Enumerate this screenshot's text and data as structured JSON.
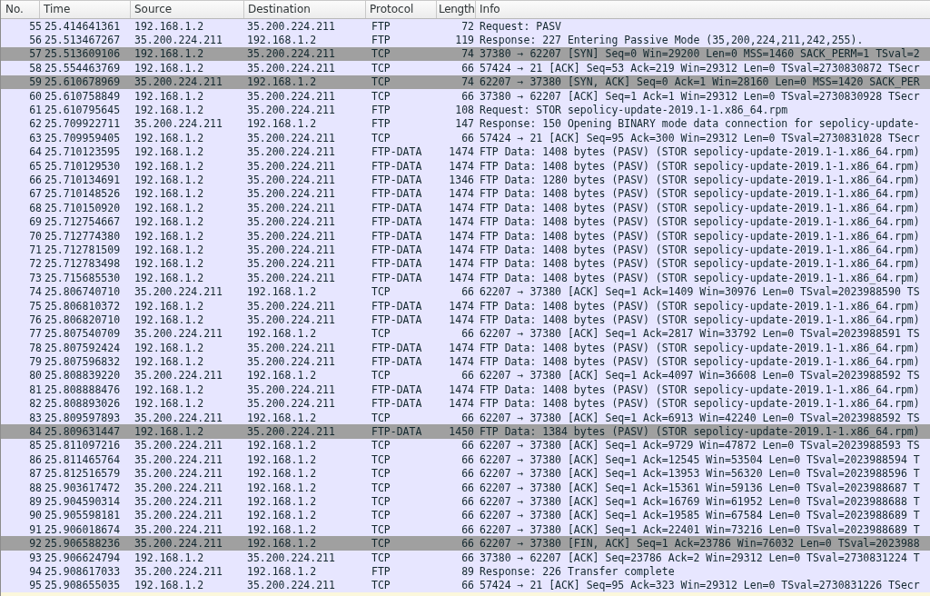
{
  "packet_list": {
    "columns": [
      "No.",
      "Time",
      "Source",
      "Destination",
      "Protocol",
      "Length",
      "Info"
    ],
    "rows": [
      {
        "no": "55",
        "time": "25.414641361",
        "source": "192.168.1.2",
        "destination": "35.200.224.211",
        "protocol": "FTP",
        "length": "72",
        "info": "Request: PASV",
        "color": "#e7e6ff",
        "selected": false
      },
      {
        "no": "56",
        "time": "25.513467267",
        "source": "35.200.224.211",
        "destination": "192.168.1.2",
        "protocol": "FTP",
        "length": "119",
        "info": "Response: 227 Entering Passive Mode (35,200,224,211,242,255).",
        "color": "#e7e6ff",
        "selected": false
      },
      {
        "no": "57",
        "time": "25.513609106",
        "source": "192.168.1.2",
        "destination": "35.200.224.211",
        "protocol": "TCP",
        "length": "74",
        "info": "37380 → 62207 [SYN] Seq=0 Win=29200 Len=0 MSS=1460 SACK_PERM=1 TSval=2",
        "color": "#a0a0a0",
        "selected": false
      },
      {
        "no": "58",
        "time": "25.554463769",
        "source": "192.168.1.2",
        "destination": "35.200.224.211",
        "protocol": "TCP",
        "length": "66",
        "info": "57424 → 21 [ACK] Seq=53 Ack=219 Win=29312 Len=0 TSval=2730830872 TSecr",
        "color": "#e7e6ff",
        "selected": false
      },
      {
        "no": "59",
        "time": "25.610678969",
        "source": "35.200.224.211",
        "destination": "192.168.1.2",
        "protocol": "TCP",
        "length": "74",
        "info": "62207 → 37380 [SYN, ACK] Seq=0 Ack=1 Win=28160 Len=0 MSS=1420 SACK_PER",
        "color": "#a0a0a0",
        "selected": false
      },
      {
        "no": "60",
        "time": "25.610758849",
        "source": "192.168.1.2",
        "destination": "35.200.224.211",
        "protocol": "TCP",
        "length": "66",
        "info": "37380 → 62207 [ACK] Seq=1 Ack=1 Win=29312 Len=0 TSval=2730830928 TSecr",
        "color": "#e7e6ff",
        "selected": false
      },
      {
        "no": "61",
        "time": "25.610795645",
        "source": "192.168.1.2",
        "destination": "35.200.224.211",
        "protocol": "FTP",
        "length": "108",
        "info": "Request: STOR sepolicy-update-2019.1-1.x86_64.rpm",
        "color": "#e7e6ff",
        "selected": false
      },
      {
        "no": "62",
        "time": "25.709922711",
        "source": "35.200.224.211",
        "destination": "192.168.1.2",
        "protocol": "FTP",
        "length": "147",
        "info": "Response: 150 Opening BINARY mode data connection for sepolicy-update-",
        "color": "#e7e6ff",
        "selected": false
      },
      {
        "no": "63",
        "time": "25.709959405",
        "source": "192.168.1.2",
        "destination": "35.200.224.211",
        "protocol": "TCP",
        "length": "66",
        "info": "57424 → 21 [ACK] Seq=95 Ack=300 Win=29312 Len=0 TSval=2730831028 TSecr",
        "color": "#e7e6ff",
        "selected": false
      },
      {
        "no": "64",
        "time": "25.710123595",
        "source": "192.168.1.2",
        "destination": "35.200.224.211",
        "protocol": "FTP-DATA",
        "length": "1474",
        "info": "FTP Data: 1408 bytes (PASV) (STOR sepolicy-update-2019.1-1.x86_64.rpm)",
        "color": "#e7e6ff",
        "selected": false
      },
      {
        "no": "65",
        "time": "25.710129530",
        "source": "192.168.1.2",
        "destination": "35.200.224.211",
        "protocol": "FTP-DATA",
        "length": "1474",
        "info": "FTP Data: 1408 bytes (PASV) (STOR sepolicy-update-2019.1-1.x86_64.rpm)",
        "color": "#e7e6ff",
        "selected": false
      },
      {
        "no": "66",
        "time": "25.710134691",
        "source": "192.168.1.2",
        "destination": "35.200.224.211",
        "protocol": "FTP-DATA",
        "length": "1346",
        "info": "FTP Data: 1280 bytes (PASV) (STOR sepolicy-update-2019.1-1.x86_64.rpm)",
        "color": "#e7e6ff",
        "selected": false
      },
      {
        "no": "67",
        "time": "25.710148526",
        "source": "192.168.1.2",
        "destination": "35.200.224.211",
        "protocol": "FTP-DATA",
        "length": "1474",
        "info": "FTP Data: 1408 bytes (PASV) (STOR sepolicy-update-2019.1-1.x86_64.rpm)",
        "color": "#e7e6ff",
        "selected": false
      },
      {
        "no": "68",
        "time": "25.710150920",
        "source": "192.168.1.2",
        "destination": "35.200.224.211",
        "protocol": "FTP-DATA",
        "length": "1474",
        "info": "FTP Data: 1408 bytes (PASV) (STOR sepolicy-update-2019.1-1.x86_64.rpm)",
        "color": "#e7e6ff",
        "selected": false
      },
      {
        "no": "69",
        "time": "25.712754667",
        "source": "192.168.1.2",
        "destination": "35.200.224.211",
        "protocol": "FTP-DATA",
        "length": "1474",
        "info": "FTP Data: 1408 bytes (PASV) (STOR sepolicy-update-2019.1-1.x86_64.rpm)",
        "color": "#e7e6ff",
        "selected": false
      },
      {
        "no": "70",
        "time": "25.712774380",
        "source": "192.168.1.2",
        "destination": "35.200.224.211",
        "protocol": "FTP-DATA",
        "length": "1474",
        "info": "FTP Data: 1408 bytes (PASV) (STOR sepolicy-update-2019.1-1.x86_64.rpm)",
        "color": "#e7e6ff",
        "selected": false
      },
      {
        "no": "71",
        "time": "25.712781509",
        "source": "192.168.1.2",
        "destination": "35.200.224.211",
        "protocol": "FTP-DATA",
        "length": "1474",
        "info": "FTP Data: 1408 bytes (PASV) (STOR sepolicy-update-2019.1-1.x86_64.rpm)",
        "color": "#e7e6ff",
        "selected": false
      },
      {
        "no": "72",
        "time": "25.712783498",
        "source": "192.168.1.2",
        "destination": "35.200.224.211",
        "protocol": "FTP-DATA",
        "length": "1474",
        "info": "FTP Data: 1408 bytes (PASV) (STOR sepolicy-update-2019.1-1.x86_64.rpm)",
        "color": "#e7e6ff",
        "selected": false
      },
      {
        "no": "73",
        "time": "25.715685530",
        "source": "192.168.1.2",
        "destination": "35.200.224.211",
        "protocol": "FTP-DATA",
        "length": "1474",
        "info": "FTP Data: 1408 bytes (PASV) (STOR sepolicy-update-2019.1-1.x86_64.rpm)",
        "color": "#e7e6ff",
        "selected": false
      },
      {
        "no": "74",
        "time": "25.806740710",
        "source": "35.200.224.211",
        "destination": "192.168.1.2",
        "protocol": "TCP",
        "length": "66",
        "info": "62207 → 37380 [ACK] Seq=1 Ack=1409 Win=30976 Len=0 TSval=2023988590 TS",
        "color": "#e7e6ff",
        "selected": false
      },
      {
        "no": "75",
        "time": "25.806810372",
        "source": "192.168.1.2",
        "destination": "35.200.224.211",
        "protocol": "FTP-DATA",
        "length": "1474",
        "info": "FTP Data: 1408 bytes (PASV) (STOR sepolicy-update-2019.1-1.x86_64.rpm)",
        "color": "#e7e6ff",
        "selected": false
      },
      {
        "no": "76",
        "time": "25.806820710",
        "source": "192.168.1.2",
        "destination": "35.200.224.211",
        "protocol": "FTP-DATA",
        "length": "1474",
        "info": "FTP Data: 1408 bytes (PASV) (STOR sepolicy-update-2019.1-1.x86_64.rpm)",
        "color": "#e7e6ff",
        "selected": false
      },
      {
        "no": "77",
        "time": "25.807540709",
        "source": "35.200.224.211",
        "destination": "192.168.1.2",
        "protocol": "TCP",
        "length": "66",
        "info": "62207 → 37380 [ACK] Seq=1 Ack=2817 Win=33792 Len=0 TSval=2023988591 TS",
        "color": "#e7e6ff",
        "selected": false
      },
      {
        "no": "78",
        "time": "25.807592424",
        "source": "192.168.1.2",
        "destination": "35.200.224.211",
        "protocol": "FTP-DATA",
        "length": "1474",
        "info": "FTP Data: 1408 bytes (PASV) (STOR sepolicy-update-2019.1-1.x86_64.rpm)",
        "color": "#e7e6ff",
        "selected": false
      },
      {
        "no": "79",
        "time": "25.807596832",
        "source": "192.168.1.2",
        "destination": "35.200.224.211",
        "protocol": "FTP-DATA",
        "length": "1474",
        "info": "FTP Data: 1408 bytes (PASV) (STOR sepolicy-update-2019.1-1.x86_64.rpm)",
        "color": "#e7e6ff",
        "selected": false
      },
      {
        "no": "80",
        "time": "25.808839220",
        "source": "35.200.224.211",
        "destination": "192.168.1.2",
        "protocol": "TCP",
        "length": "66",
        "info": "62207 → 37380 [ACK] Seq=1 Ack=4097 Win=36608 Len=0 TSval=2023988592 TS",
        "color": "#e7e6ff",
        "selected": false
      },
      {
        "no": "81",
        "time": "25.808888476",
        "source": "192.168.1.2",
        "destination": "35.200.224.211",
        "protocol": "FTP-DATA",
        "length": "1474",
        "info": "FTP Data: 1408 bytes (PASV) (STOR sepolicy-update-2019.1-1.x86_64.rpm)",
        "color": "#e7e6ff",
        "selected": false
      },
      {
        "no": "82",
        "time": "25.808893026",
        "source": "192.168.1.2",
        "destination": "35.200.224.211",
        "protocol": "FTP-DATA",
        "length": "1474",
        "info": "FTP Data: 1408 bytes (PASV) (STOR sepolicy-update-2019.1-1.x86_64.rpm)",
        "color": "#e7e6ff",
        "selected": false
      },
      {
        "no": "83",
        "time": "25.809597893",
        "source": "35.200.224.211",
        "destination": "192.168.1.2",
        "protocol": "TCP",
        "length": "66",
        "info": "62207 → 37380 [ACK] Seq=1 Ack=6913 Win=42240 Len=0 TSval=2023988592 TS",
        "color": "#e7e6ff",
        "selected": false
      },
      {
        "no": "84",
        "time": "25.809631447",
        "source": "192.168.1.2",
        "destination": "35.200.224.211",
        "protocol": "FTP-DATA",
        "length": "1450",
        "info": "FTP Data: 1384 bytes (PASV) (STOR sepolicy-update-2019.1-1.x86_64.rpm)",
        "color": "#a0a0a0",
        "selected": false
      },
      {
        "no": "85",
        "time": "25.811097216",
        "source": "35.200.224.211",
        "destination": "192.168.1.2",
        "protocol": "TCP",
        "length": "66",
        "info": "62207 → 37380 [ACK] Seq=1 Ack=9729 Win=47872 Len=0 TSval=2023988593 TS",
        "color": "#e7e6ff",
        "selected": false
      },
      {
        "no": "86",
        "time": "25.811465764",
        "source": "35.200.224.211",
        "destination": "192.168.1.2",
        "protocol": "TCP",
        "length": "66",
        "info": "62207 → 37380 [ACK] Seq=1 Ack=12545 Win=53504 Len=0 TSval=2023988594 T",
        "color": "#e7e6ff",
        "selected": false
      },
      {
        "no": "87",
        "time": "25.812516579",
        "source": "35.200.224.211",
        "destination": "192.168.1.2",
        "protocol": "TCP",
        "length": "66",
        "info": "62207 → 37380 [ACK] Seq=1 Ack=13953 Win=56320 Len=0 TSval=2023988596 T",
        "color": "#e7e6ff",
        "selected": false
      },
      {
        "no": "88",
        "time": "25.903617472",
        "source": "35.200.224.211",
        "destination": "192.168.1.2",
        "protocol": "TCP",
        "length": "66",
        "info": "62207 → 37380 [ACK] Seq=1 Ack=15361 Win=59136 Len=0 TSval=2023988687 T",
        "color": "#e7e6ff",
        "selected": false
      },
      {
        "no": "89",
        "time": "25.904590314",
        "source": "35.200.224.211",
        "destination": "192.168.1.2",
        "protocol": "TCP",
        "length": "66",
        "info": "62207 → 37380 [ACK] Seq=1 Ack=16769 Win=61952 Len=0 TSval=2023988688 T",
        "color": "#e7e6ff",
        "selected": false
      },
      {
        "no": "90",
        "time": "25.905598181",
        "source": "35.200.224.211",
        "destination": "192.168.1.2",
        "protocol": "TCP",
        "length": "66",
        "info": "62207 → 37380 [ACK] Seq=1 Ack=19585 Win=67584 Len=0 TSval=2023988689 T",
        "color": "#e7e6ff",
        "selected": false
      },
      {
        "no": "91",
        "time": "25.906018674",
        "source": "35.200.224.211",
        "destination": "192.168.1.2",
        "protocol": "TCP",
        "length": "66",
        "info": "62207 → 37380 [ACK] Seq=1 Ack=22401 Win=73216 Len=0 TSval=2023988689 T",
        "color": "#e7e6ff",
        "selected": false
      },
      {
        "no": "92",
        "time": "25.906588236",
        "source": "35.200.224.211",
        "destination": "192.168.1.2",
        "protocol": "TCP",
        "length": "66",
        "info": "62207 → 37380 [FIN, ACK] Seq=1 Ack=23786 Win=76032 Len=0 TSval=2023988",
        "color": "#a0a0a0",
        "selected": false
      },
      {
        "no": "93",
        "time": "25.906624794",
        "source": "192.168.1.2",
        "destination": "35.200.224.211",
        "protocol": "TCP",
        "length": "66",
        "info": "37380 → 62207 [ACK] Seq=23786 Ack=2 Win=29312 Len=0 TSval=2730831224 T",
        "color": "#e7e6ff",
        "selected": false
      },
      {
        "no": "94",
        "time": "25.908617033",
        "source": "35.200.224.211",
        "destination": "192.168.1.2",
        "protocol": "FTP",
        "length": "89",
        "info": "Response: 226 Transfer complete",
        "color": "#e7e6ff",
        "selected": false
      },
      {
        "no": "95",
        "time": "25.908655035",
        "source": "192.168.1.2",
        "destination": "35.200.224.211",
        "protocol": "TCP",
        "length": "66",
        "info": "57424 → 21 [ACK] Seq=95 Ack=323 Win=29312 Len=0 TSval=2730831226 TSecr",
        "color": "#e7e6ff",
        "selected": false
      }
    ]
  }
}
